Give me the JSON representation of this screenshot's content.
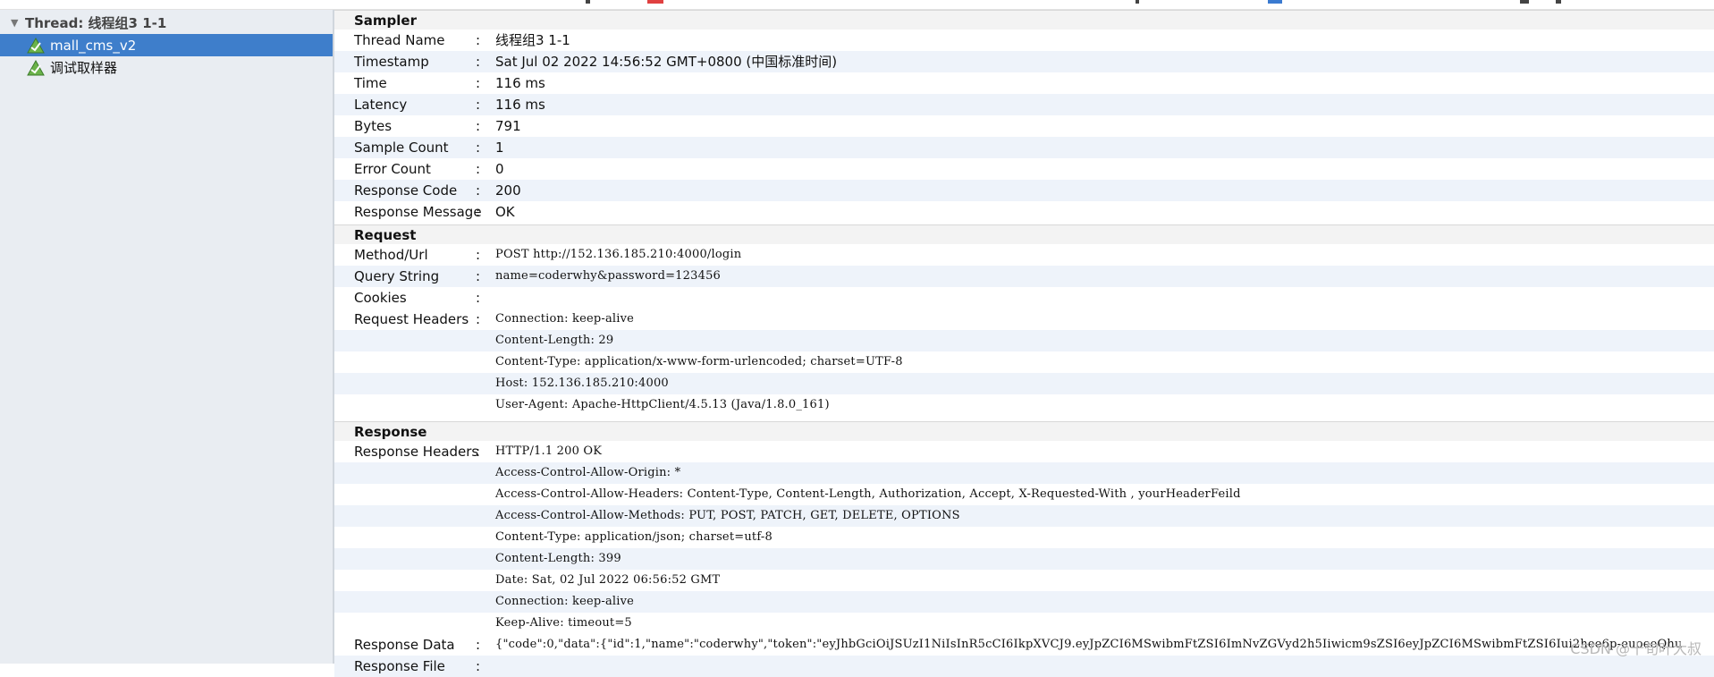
{
  "tree": {
    "thread_label": "Thread: 线程组3 1-1",
    "items": [
      {
        "label": "mall_cms_v2",
        "selected": true
      },
      {
        "label": "调试取样器",
        "selected": false
      }
    ]
  },
  "sections": {
    "sampler": "Sampler",
    "request": "Request",
    "response": "Response"
  },
  "sampler": [
    {
      "key": "Thread Name",
      "value": "线程组3 1-1"
    },
    {
      "key": "Timestamp",
      "value": "Sat Jul 02 2022 14:56:52 GMT+0800 (中国标准时间)"
    },
    {
      "key": "Time",
      "value": "116 ms"
    },
    {
      "key": "Latency",
      "value": "116 ms"
    },
    {
      "key": "Bytes",
      "value": "791"
    },
    {
      "key": "Sample Count",
      "value": "1"
    },
    {
      "key": "Error Count",
      "value": "0"
    },
    {
      "key": "Response Code",
      "value": "200"
    },
    {
      "key": "Response Message",
      "value": "OK"
    }
  ],
  "request": {
    "method_url_key": "Method/Url",
    "method_url": "POST http://152.136.185.210:4000/login",
    "query_key": "Query String",
    "query": "name=coderwhy&password=123456",
    "cookies_key": "Cookies",
    "headers_key": "Request Headers",
    "headers": [
      "Connection: keep-alive",
      "Content-Length: 29",
      "Content-Type: application/x-www-form-urlencoded; charset=UTF-8",
      "Host: 152.136.185.210:4000",
      "User-Agent: Apache-HttpClient/4.5.13 (Java/1.8.0_161)"
    ]
  },
  "response": {
    "headers_key": "Response Headers",
    "headers": [
      "HTTP/1.1 200 OK",
      "Access-Control-Allow-Origin: *",
      "Access-Control-Allow-Headers: Content-Type, Content-Length, Authorization, Accept, X-Requested-With , yourHeaderFeild",
      "Access-Control-Allow-Methods: PUT, POST, PATCH, GET, DELETE, OPTIONS",
      "Content-Type: application/json; charset=utf-8",
      "Content-Length: 399",
      "Date: Sat, 02 Jul 2022 06:56:52 GMT",
      "Connection: keep-alive",
      "Keep-Alive: timeout=5"
    ],
    "data_key": "Response Data",
    "data": "{\"code\":0,\"data\":{\"id\":1,\"name\":\"coderwhy\",\"token\":\"eyJhbGciOiJSUzI1NiIsInR5cCI6IkpXVCJ9.eyJpZCI6MSwibmFtZSI6ImNvZGVyd2h5Iiwicm9sZSI6eyJpZCI6MSwibmFtZSI6Iui2hee6p-euoeeQhu",
    "file_key": "Response File"
  },
  "separator": ":",
  "watermark": "CSDN @十旬叶大叔",
  "colors": {
    "selection": "#3e7ecb",
    "sidebar_bg": "#e9edf2",
    "alt_row": "#eef3fa"
  }
}
